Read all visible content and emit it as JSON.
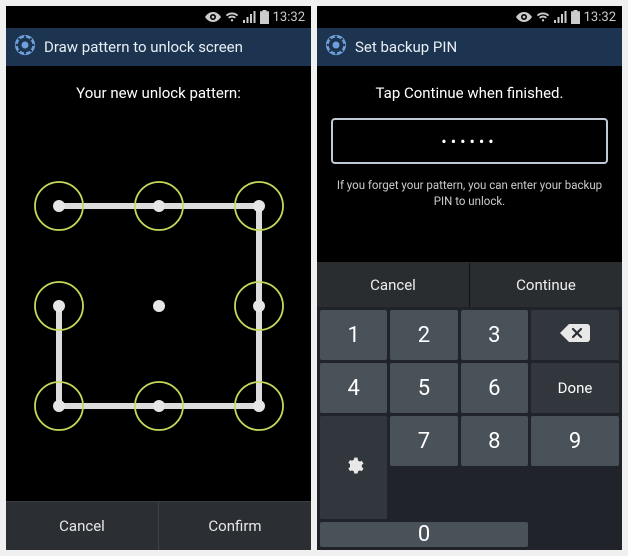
{
  "status": {
    "time": "13:32"
  },
  "left": {
    "title": "Draw pattern to unlock screen",
    "subtitle": "Your new unlock pattern:",
    "cancel": "Cancel",
    "confirm": "Confirm",
    "pattern_sequence": [
      0,
      1,
      2,
      5,
      8,
      7,
      6,
      3
    ],
    "dot_count": 9,
    "accent_ring": "#c7d95a"
  },
  "right": {
    "title": "Set backup PIN",
    "subtitle": "Tap Continue when finished.",
    "pin_masked": "••••••",
    "helper": "If you forget your pattern, you can enter your backup PIN to unlock.",
    "cancel": "Cancel",
    "continue": "Continue",
    "keys": {
      "1": "1",
      "2": "2",
      "3": "3",
      "4": "4",
      "5": "5",
      "6": "6",
      "7": "7",
      "8": "8",
      "9": "9",
      "0": "0",
      "done": "Done"
    }
  }
}
